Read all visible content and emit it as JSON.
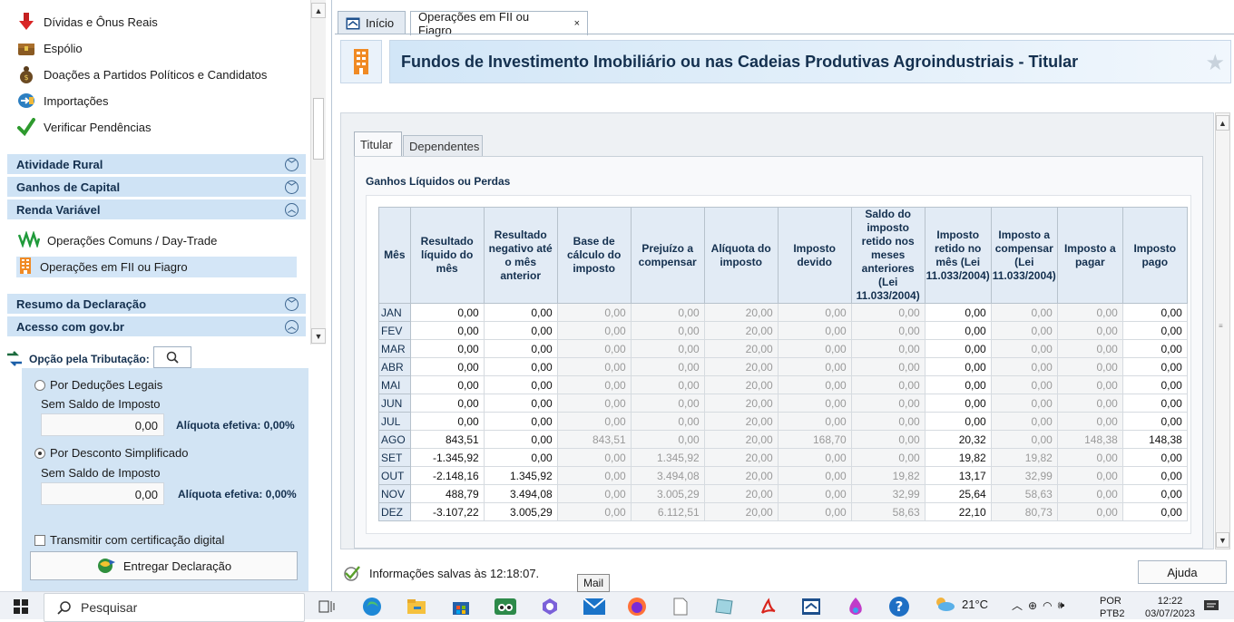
{
  "sidebar": {
    "items": [
      {
        "label": "Dívidas e Ônus Reais",
        "icon": "arrow-down-debt-icon"
      },
      {
        "label": "Espólio",
        "icon": "chest-icon"
      },
      {
        "label": "Doações a Partidos Políticos e Candidatos",
        "icon": "money-bag-icon"
      },
      {
        "label": "Importações",
        "icon": "import-icon"
      },
      {
        "label": "Verificar Pendências",
        "icon": "check-icon"
      }
    ],
    "categories": {
      "atividade_rural": "Atividade Rural",
      "ganhos_capital": "Ganhos de Capital",
      "renda_variavel": "Renda Variável",
      "resumo": "Resumo da Declaração",
      "acesso": "Acesso com gov.br"
    },
    "renda_variavel_items": [
      {
        "label": "Operações Comuns / Day-Trade",
        "icon": "chart-line-icon"
      },
      {
        "label": "Operações em FII ou Fiagro",
        "icon": "building-icon"
      }
    ]
  },
  "opcao": {
    "title": "Opção pela Tributação:",
    "deducoes_label": "Por Deduções Legais",
    "deducoes_status": "Sem Saldo de Imposto",
    "deducoes_value": "0,00",
    "deducoes_aliquota": "Alíquota efetiva: 0,00%",
    "simplificado_label": "Por Desconto Simplificado",
    "simplificado_status": "Sem Saldo de Imposto",
    "simplificado_value": "0,00",
    "simplificado_aliquota": "Alíquota efetiva: 0,00%",
    "selected": "simplificado",
    "transmitir_label": "Transmitir com certificação digital",
    "entregar_label": "Entregar Declaração"
  },
  "tabs": [
    {
      "label": "Início",
      "active": false
    },
    {
      "label": "Operações em FII ou Fiagro",
      "active": true,
      "close": "×"
    }
  ],
  "header": {
    "title": "Fundos de Investimento Imobiliário ou nas Cadeias Produtivas Agroindustriais - Titular"
  },
  "subtabs": {
    "titular": "Titular",
    "dependentes": "Dependentes"
  },
  "section_title": "Ganhos Líquidos ou Perdas",
  "table": {
    "columns": [
      "Mês",
      "Resultado líquido do mês",
      "Resultado negativo até o mês anterior",
      "Base de cálculo do imposto",
      "Prejuízo a compensar",
      "Alíquota do imposto",
      "Imposto devido",
      "Saldo do imposto retido nos meses anteriores (Lei 11.033/2004)",
      "Imposto retido no mês (Lei 11.033/2004)",
      "Imposto a compensar (Lei 11.033/2004)",
      "Imposto a pagar",
      "Imposto pago"
    ],
    "editable_columns": [
      1,
      2,
      8,
      11
    ],
    "rows": [
      [
        "JAN",
        "0,00",
        "0,00",
        "0,00",
        "0,00",
        "20,00",
        "0,00",
        "0,00",
        "0,00",
        "0,00",
        "0,00",
        "0,00"
      ],
      [
        "FEV",
        "0,00",
        "0,00",
        "0,00",
        "0,00",
        "20,00",
        "0,00",
        "0,00",
        "0,00",
        "0,00",
        "0,00",
        "0,00"
      ],
      [
        "MAR",
        "0,00",
        "0,00",
        "0,00",
        "0,00",
        "20,00",
        "0,00",
        "0,00",
        "0,00",
        "0,00",
        "0,00",
        "0,00"
      ],
      [
        "ABR",
        "0,00",
        "0,00",
        "0,00",
        "0,00",
        "20,00",
        "0,00",
        "0,00",
        "0,00",
        "0,00",
        "0,00",
        "0,00"
      ],
      [
        "MAI",
        "0,00",
        "0,00",
        "0,00",
        "0,00",
        "20,00",
        "0,00",
        "0,00",
        "0,00",
        "0,00",
        "0,00",
        "0,00"
      ],
      [
        "JUN",
        "0,00",
        "0,00",
        "0,00",
        "0,00",
        "20,00",
        "0,00",
        "0,00",
        "0,00",
        "0,00",
        "0,00",
        "0,00"
      ],
      [
        "JUL",
        "0,00",
        "0,00",
        "0,00",
        "0,00",
        "20,00",
        "0,00",
        "0,00",
        "0,00",
        "0,00",
        "0,00",
        "0,00"
      ],
      [
        "AGO",
        "843,51",
        "0,00",
        "843,51",
        "0,00",
        "20,00",
        "168,70",
        "0,00",
        "20,32",
        "0,00",
        "148,38",
        "148,38"
      ],
      [
        "SET",
        "-1.345,92",
        "0,00",
        "0,00",
        "1.345,92",
        "20,00",
        "0,00",
        "0,00",
        "19,82",
        "19,82",
        "0,00",
        "0,00"
      ],
      [
        "OUT",
        "-2.148,16",
        "1.345,92",
        "0,00",
        "3.494,08",
        "20,00",
        "0,00",
        "19,82",
        "13,17",
        "32,99",
        "0,00",
        "0,00"
      ],
      [
        "NOV",
        "488,79",
        "3.494,08",
        "0,00",
        "3.005,29",
        "20,00",
        "0,00",
        "32,99",
        "25,64",
        "58,63",
        "0,00",
        "0,00"
      ],
      [
        "DEZ",
        "-3.107,22",
        "3.005,29",
        "0,00",
        "6.112,51",
        "20,00",
        "0,00",
        "58,63",
        "22,10",
        "80,73",
        "0,00",
        "0,00"
      ]
    ]
  },
  "status": {
    "text": "Informações salvas às 12:18:07."
  },
  "ajuda_label": "Ajuda",
  "tooltip": "Mail",
  "taskbar": {
    "search_placeholder": "Pesquisar",
    "weather": "21°C",
    "lang1": "POR",
    "lang2": "PTB2",
    "time": "12:22",
    "date": "03/07/2023"
  }
}
